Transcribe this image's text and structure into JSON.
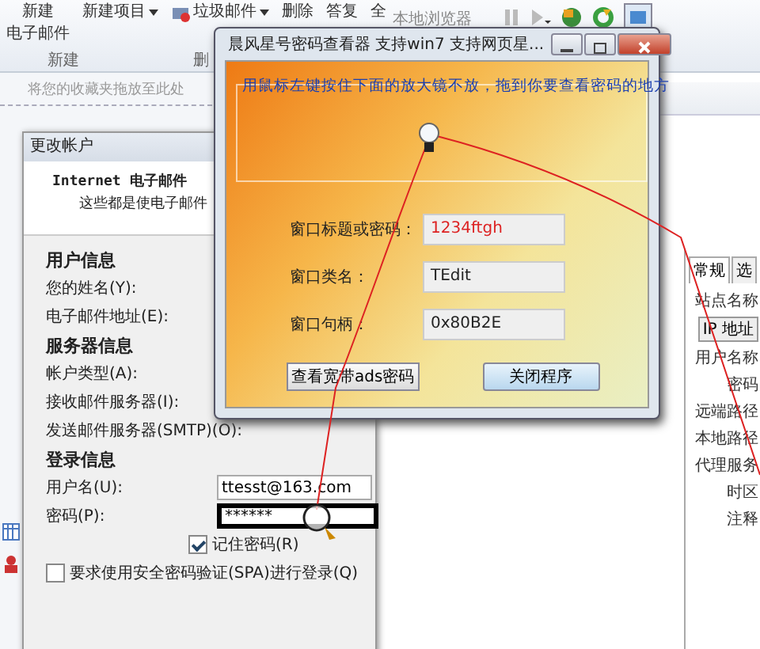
{
  "ribbon": {
    "items": [
      {
        "lines": [
          "新建",
          "电子邮件"
        ],
        "kind": "large"
      },
      {
        "label": "新建项目",
        "kind": "dropdown"
      },
      {
        "label": "垃圾邮件",
        "kind": "dropdown-icon"
      },
      {
        "label": "删除",
        "kind": "plain"
      },
      {
        "label": "答复",
        "kind": "plain"
      },
      {
        "label": "全",
        "kind": "plain"
      }
    ],
    "group_labels": [
      "新建",
      "删"
    ],
    "local_browser": "本地浏览器"
  },
  "favorites_bar": {
    "placeholder": "将您的收藏夹拖放至此处"
  },
  "account_dialog": {
    "title": "更改帐户",
    "heading": "Internet 电子邮件",
    "subheading": "这些都是使电子邮件",
    "rows": [
      {
        "kind": "section",
        "label": "用户信息"
      },
      {
        "kind": "label",
        "label": "您的姓名(Y):"
      },
      {
        "kind": "label",
        "label": "电子邮件地址(E):"
      },
      {
        "kind": "section",
        "label": "服务器信息"
      },
      {
        "kind": "label",
        "label": "帐户类型(A):"
      },
      {
        "kind": "label",
        "label": "接收邮件服务器(I):"
      },
      {
        "kind": "label",
        "label": "发送邮件服务器(SMTP)(O):"
      },
      {
        "kind": "section",
        "label": "登录信息"
      },
      {
        "kind": "field",
        "label": "用户名(U):",
        "value": "ttesst@163.com"
      },
      {
        "kind": "password",
        "label": "密码(P):",
        "value": "******"
      }
    ],
    "checkboxes": [
      {
        "label": "记住密码(R)",
        "checked": true
      },
      {
        "label": "要求使用安全密码验证(SPA)进行登录(Q)",
        "checked": false
      }
    ]
  },
  "viewer": {
    "title": "晨风星号密码查看器 支持win7 支持网页星...",
    "instruction": "用鼠标左键按住下面的放大镜不放，拖到你要查看密码的地方",
    "fields": [
      {
        "label": "窗口标题或密码：",
        "value": "1234ftgh",
        "highlight": true
      },
      {
        "label": "窗口类名：",
        "value": "TEdit",
        "highlight": false
      },
      {
        "label": "窗口句柄：",
        "value": "0x80B2E",
        "highlight": false
      }
    ],
    "buttons": [
      "查看宽带ads密码",
      "关闭程序"
    ]
  },
  "site_dialog": {
    "tabs": [
      {
        "label": "常规",
        "selected": true
      },
      {
        "label": "选",
        "selected": false
      }
    ],
    "rows": [
      {
        "kind": "label",
        "label": "站点名称"
      },
      {
        "kind": "button",
        "label": "IP 地址"
      },
      {
        "kind": "label",
        "label": "用户名称"
      },
      {
        "kind": "label",
        "label": "密码"
      },
      {
        "kind": "label",
        "label": "远端路径"
      },
      {
        "kind": "label",
        "label": "本地路径"
      },
      {
        "kind": "label",
        "label": "代理服务"
      },
      {
        "kind": "label",
        "label": "时区"
      },
      {
        "kind": "label",
        "label": "注释"
      }
    ]
  }
}
